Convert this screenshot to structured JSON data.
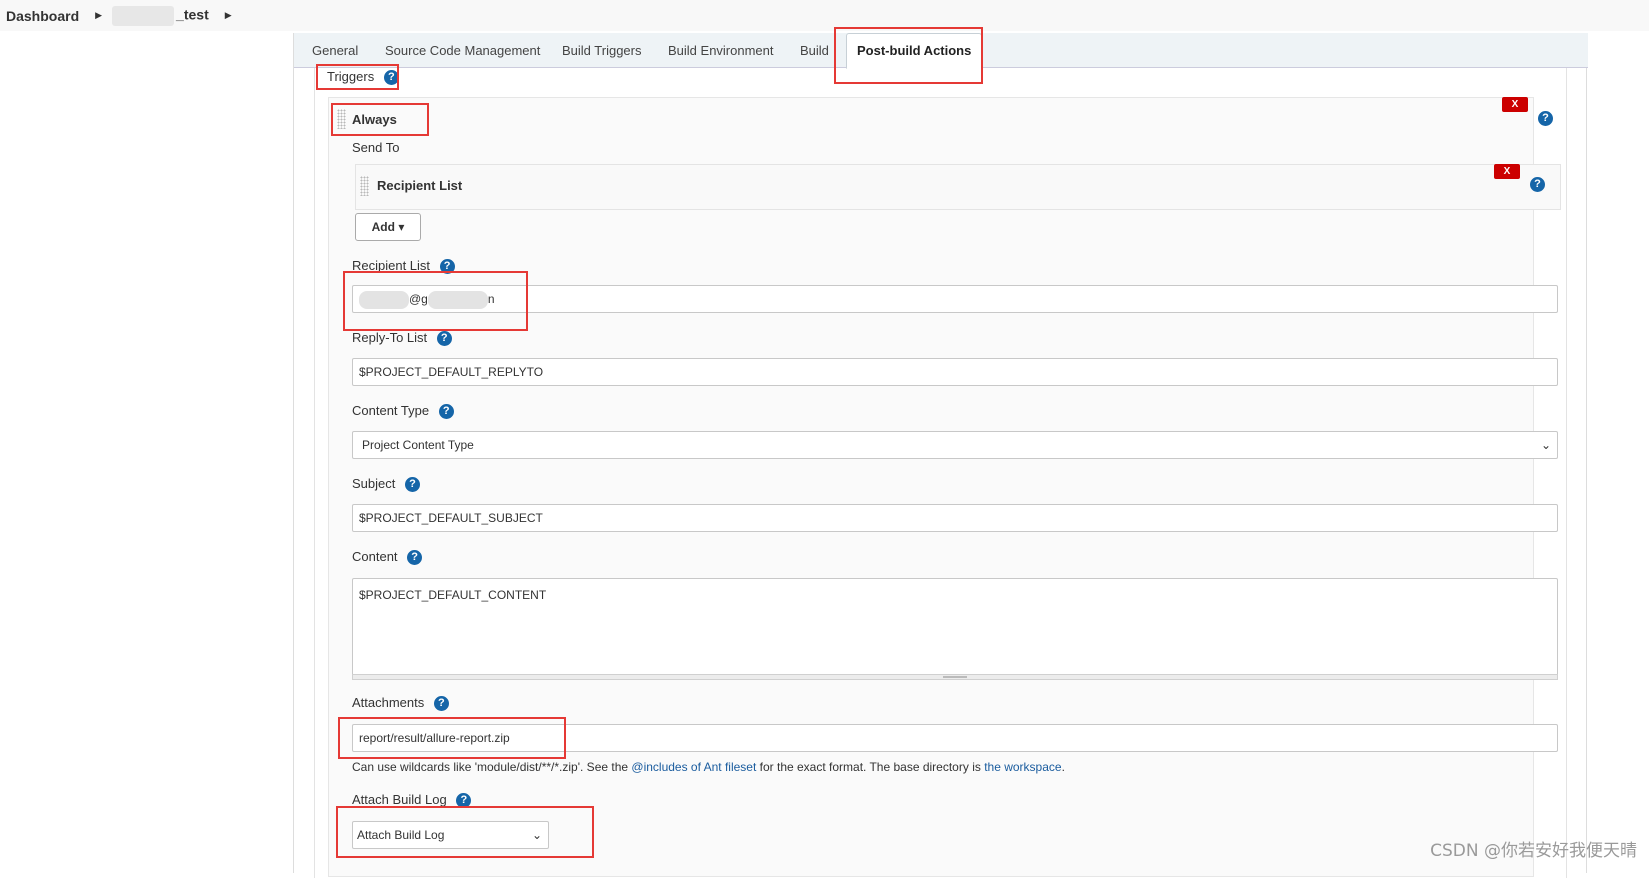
{
  "breadcrumb": {
    "root": "Dashboard",
    "project_suffix": "_test"
  },
  "tabs": [
    "General",
    "Source Code Management",
    "Build Triggers",
    "Build Environment",
    "Build",
    "Post-build Actions"
  ],
  "triggers_label": "Triggers",
  "trigger": {
    "title": "Always",
    "send_to_label": "Send To",
    "recipient_item": "Recipient List",
    "add_button": "Add",
    "delete_label": "X"
  },
  "fields": {
    "recipient_list": {
      "label": "Recipient List",
      "value_visible": "@g",
      "value_end": "n"
    },
    "reply_to": {
      "label": "Reply-To List",
      "value": "$PROJECT_DEFAULT_REPLYTO"
    },
    "content_type": {
      "label": "Content Type",
      "value": "Project Content Type"
    },
    "subject": {
      "label": "Subject",
      "value": "$PROJECT_DEFAULT_SUBJECT"
    },
    "content": {
      "label": "Content",
      "value": "$PROJECT_DEFAULT_CONTENT"
    },
    "attachments": {
      "label": "Attachments",
      "value": "report/result/allure-report.zip"
    },
    "attach_build_log": {
      "label": "Attach Build Log",
      "value": "Attach Build Log"
    }
  },
  "attachments_note": {
    "prefix": "Can use wildcards like 'module/dist/**/*.zip'. See the ",
    "link1": "@includes of Ant fileset",
    "middle": " for the exact format. The base directory is ",
    "link2": "the workspace",
    "suffix": "."
  },
  "watermark": "CSDN @你若安好我便天晴",
  "icons": {
    "help": "?",
    "dropdown": "▾",
    "chevron": "⌄",
    "breadcrumb_arrow": "▶"
  },
  "colors": {
    "accent": "#1565a8",
    "delete": "#cc0000",
    "highlight": "#e53935"
  }
}
